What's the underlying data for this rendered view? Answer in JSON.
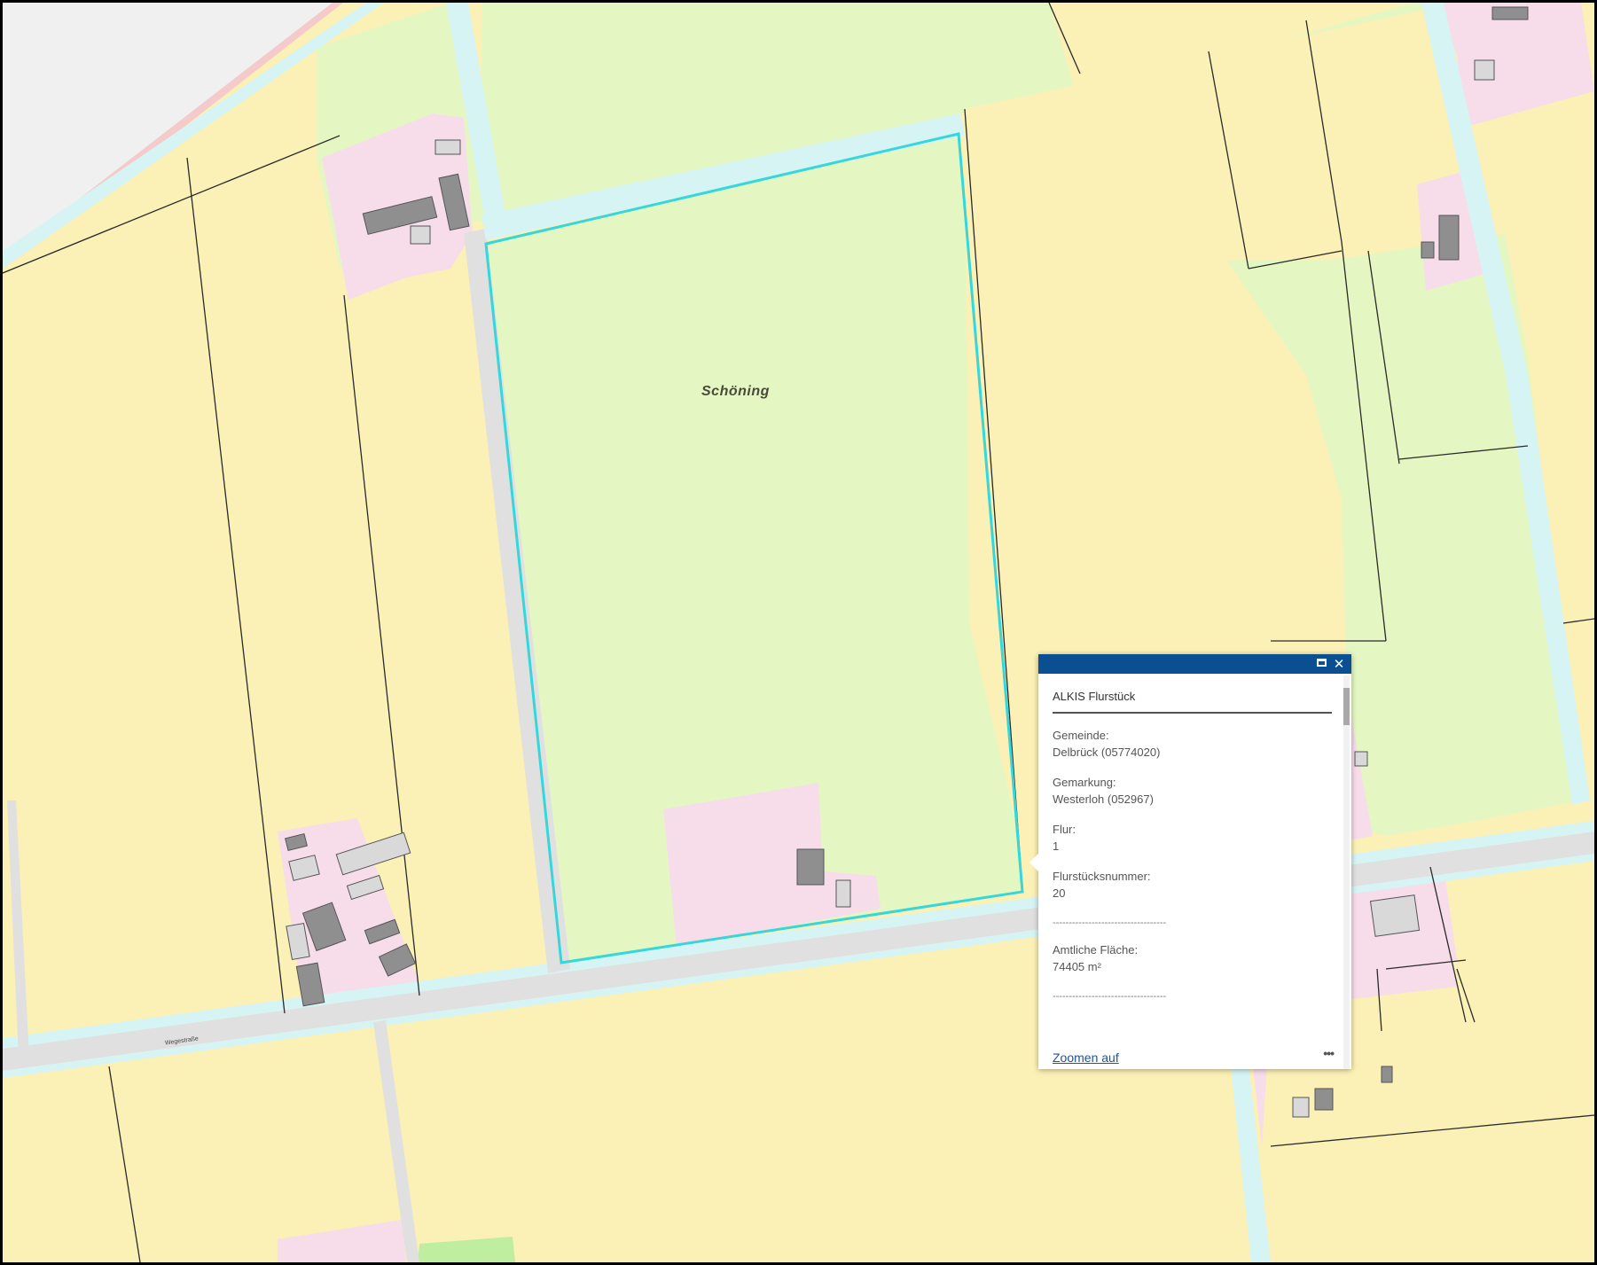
{
  "map": {
    "colors": {
      "residential_yellow": "#fbf0b6",
      "grassland_green": "#e4f7c3",
      "settlement_pink": "#f7dcea",
      "road_gray": "#e3e3e3",
      "ditch_cyan": "#d6f4f4",
      "building_gray": "#8f8f8f",
      "highlight_cyan": "#35d7db",
      "parcel_line": "#2a2a2a"
    },
    "place_label": "Schöning",
    "street_label": "Wegestraße"
  },
  "popup": {
    "title": "ALKIS Flurstück",
    "maximize_icon": "maximize-icon",
    "close_icon": "close-icon",
    "close_glyph": "✕",
    "fields": [
      {
        "label": "Gemeinde:",
        "value": "Delbrück (05774020)"
      },
      {
        "label": "Gemarkung:",
        "value": "Westerloh (052967)"
      },
      {
        "label": "Flur:",
        "value": "1"
      },
      {
        "label": "Flurstücksnummer:",
        "value": "20"
      }
    ],
    "divider_1": "-----------------------------------",
    "area_label": "Amtliche Fläche:",
    "area_value": "74405 m²",
    "divider_2": "-----------------------------------",
    "zoom_link": "Zoomen auf",
    "more_glyph": "•••"
  }
}
